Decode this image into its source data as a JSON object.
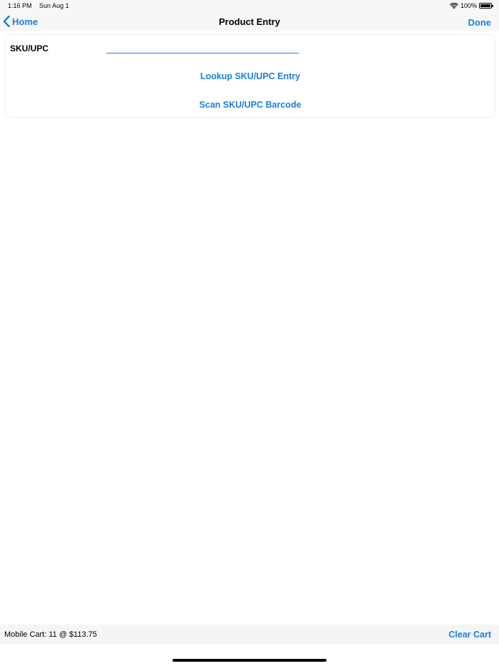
{
  "status_bar": {
    "time": "1:16 PM",
    "date": "Sun Aug 1",
    "battery_percent": "100%",
    "battery_level": 1.0,
    "icons": [
      "wifi-icon",
      "battery-icon"
    ]
  },
  "nav": {
    "back_label": "Home",
    "title": "Product Entry",
    "done_label": "Done",
    "back_icon": "chevron-left-icon"
  },
  "form": {
    "sku_label": "SKU/UPC",
    "sku_value": "",
    "sku_placeholder": "",
    "lookup_label": "Lookup SKU/UPC Entry",
    "scan_label": "Scan SKU/UPC Barcode"
  },
  "bottom_bar": {
    "cart_summary": "Mobile Cart: 11 @ $113.75",
    "clear_label": "Clear Cart"
  },
  "colors": {
    "accent": "#1a7fe0",
    "bar_background": "#f7f7f7"
  }
}
